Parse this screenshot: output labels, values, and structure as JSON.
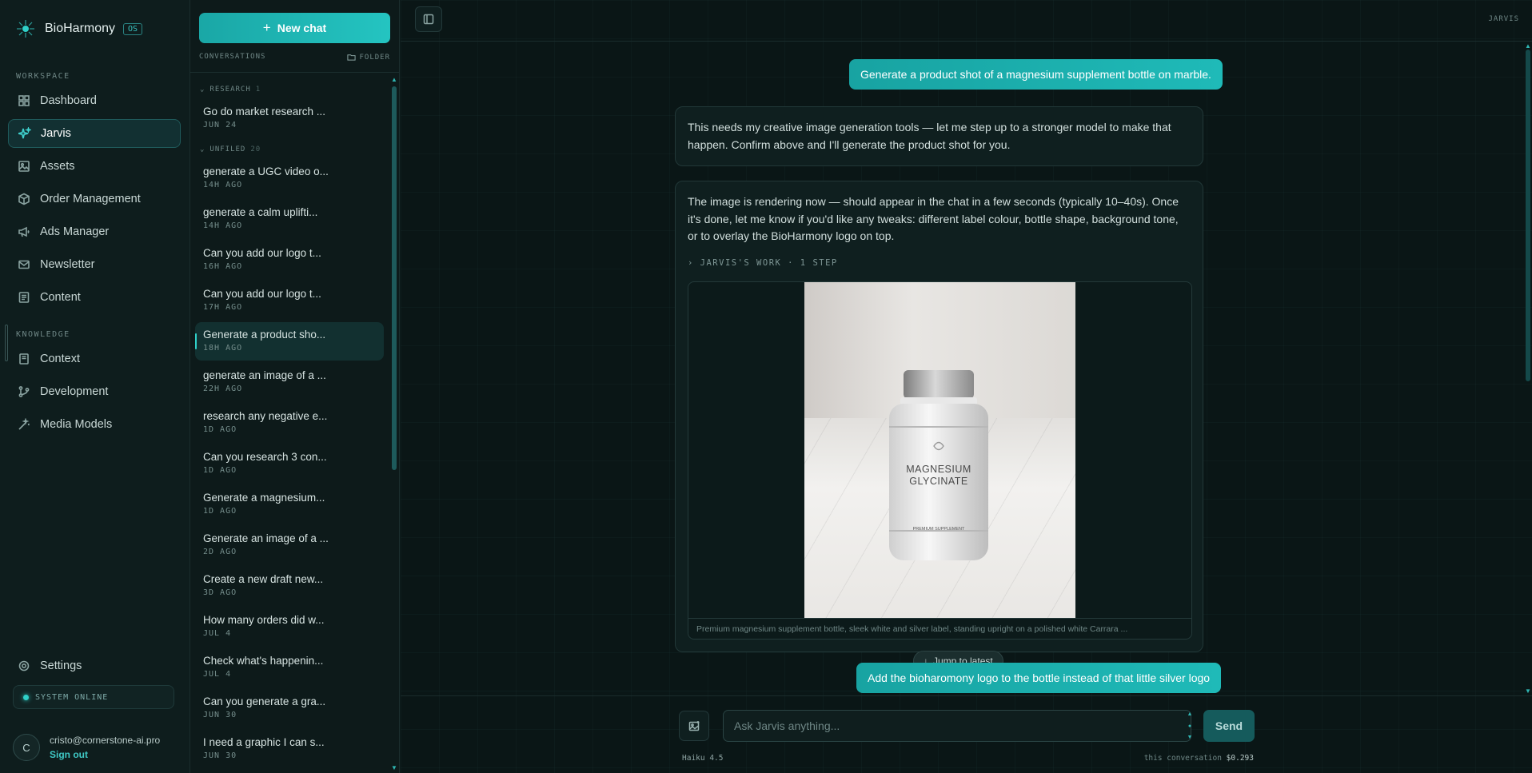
{
  "brand": {
    "name": "BioHarmony",
    "badge": "OS"
  },
  "sidebar": {
    "workspace_label": "WORKSPACE",
    "workspace_items": [
      {
        "label": "Dashboard",
        "icon": "grid-icon"
      },
      {
        "label": "Jarvis",
        "icon": "sparkle-icon",
        "active": true
      },
      {
        "label": "Assets",
        "icon": "image-icon"
      },
      {
        "label": "Order Management",
        "icon": "box-icon"
      },
      {
        "label": "Ads Manager",
        "icon": "megaphone-icon"
      },
      {
        "label": "Newsletter",
        "icon": "mail-icon"
      },
      {
        "label": "Content",
        "icon": "document-icon"
      }
    ],
    "knowledge_label": "KNOWLEDGE",
    "knowledge_items": [
      {
        "label": "Context",
        "icon": "book-icon"
      },
      {
        "label": "Development",
        "icon": "branch-icon"
      },
      {
        "label": "Media Models",
        "icon": "wand-icon"
      }
    ],
    "settings_label": "Settings",
    "system_status": "SYSTEM ONLINE",
    "user": {
      "initial": "C",
      "email": "cristo@cornerstone-ai.pro",
      "sign_out": "Sign out"
    }
  },
  "conversations": {
    "new_chat_label": "New chat",
    "header_label": "CONVERSATIONS",
    "folder_label": "FOLDER",
    "groups": [
      {
        "name": "RESEARCH",
        "count": "1"
      },
      {
        "name": "UNFILED",
        "count": "20"
      }
    ],
    "items": [
      {
        "title": "Go do market research ...",
        "date": "JUN 24"
      },
      {
        "title": "generate a UGC video o...",
        "date": "14H AGO"
      },
      {
        "title": "generate a calm uplifti...",
        "date": "14H AGO"
      },
      {
        "title": "Can you add our logo t...",
        "date": "16H AGO"
      },
      {
        "title": "Can you add our logo t...",
        "date": "17H AGO"
      },
      {
        "title": "Generate a product sho...",
        "date": "18H AGO",
        "active": true
      },
      {
        "title": "generate an image of a ...",
        "date": "22H AGO"
      },
      {
        "title": "research any negative e...",
        "date": "1D AGO"
      },
      {
        "title": "Can you research 3 con...",
        "date": "1D AGO"
      },
      {
        "title": "Generate a magnesium...",
        "date": "1D AGO"
      },
      {
        "title": "Generate an image of a ...",
        "date": "2D AGO"
      },
      {
        "title": "Create a new draft new...",
        "date": "3D AGO"
      },
      {
        "title": "How many orders did w...",
        "date": "JUL 4"
      },
      {
        "title": "Check what's happenin...",
        "date": "JUL 4"
      },
      {
        "title": "Can you generate a gra...",
        "date": "JUN 30"
      },
      {
        "title": "I need a graphic I can s...",
        "date": "JUN 30"
      }
    ]
  },
  "main": {
    "top_right_label": "JARVIS",
    "messages": {
      "user_1": "Generate a product shot of a magnesium supplement bottle on marble.",
      "ai_1": "This needs my creative image generation tools — let me step up to a stronger model to make that happen. Confirm above and I'll generate the product shot for you.",
      "ai_2": "The image is rendering now — should appear in the chat in a few seconds (typically 10–40s). Once it's done, let me know if you'd like any tweaks: different label colour, bottle shape, background tone, or to overlay the BioHarmony logo on top.",
      "work_label": "JARVIS'S WORK · 1 STEP",
      "image_label_line1": "MAGNESIUM",
      "image_label_line2": "GLYCINATE",
      "image_label_sub": "PREMIUM SUPPLEMENT",
      "image_caption": "Premium magnesium supplement bottle, sleek white and silver label, standing upright on a polished white Carrara ...",
      "user_2": "Add the bioharomony logo to the bottle instead of that little silver logo"
    },
    "jump_label": "Jump to latest",
    "composer": {
      "placeholder": "Ask Jarvis anything...",
      "send_label": "Send"
    },
    "model_label": "Haiku 4.5",
    "cost_prefix": "this conversation",
    "cost_value": "$0.293"
  },
  "colors": {
    "accent": "#24c4c1",
    "background": "#0a1616",
    "sidebar": "#0e1d1d"
  }
}
